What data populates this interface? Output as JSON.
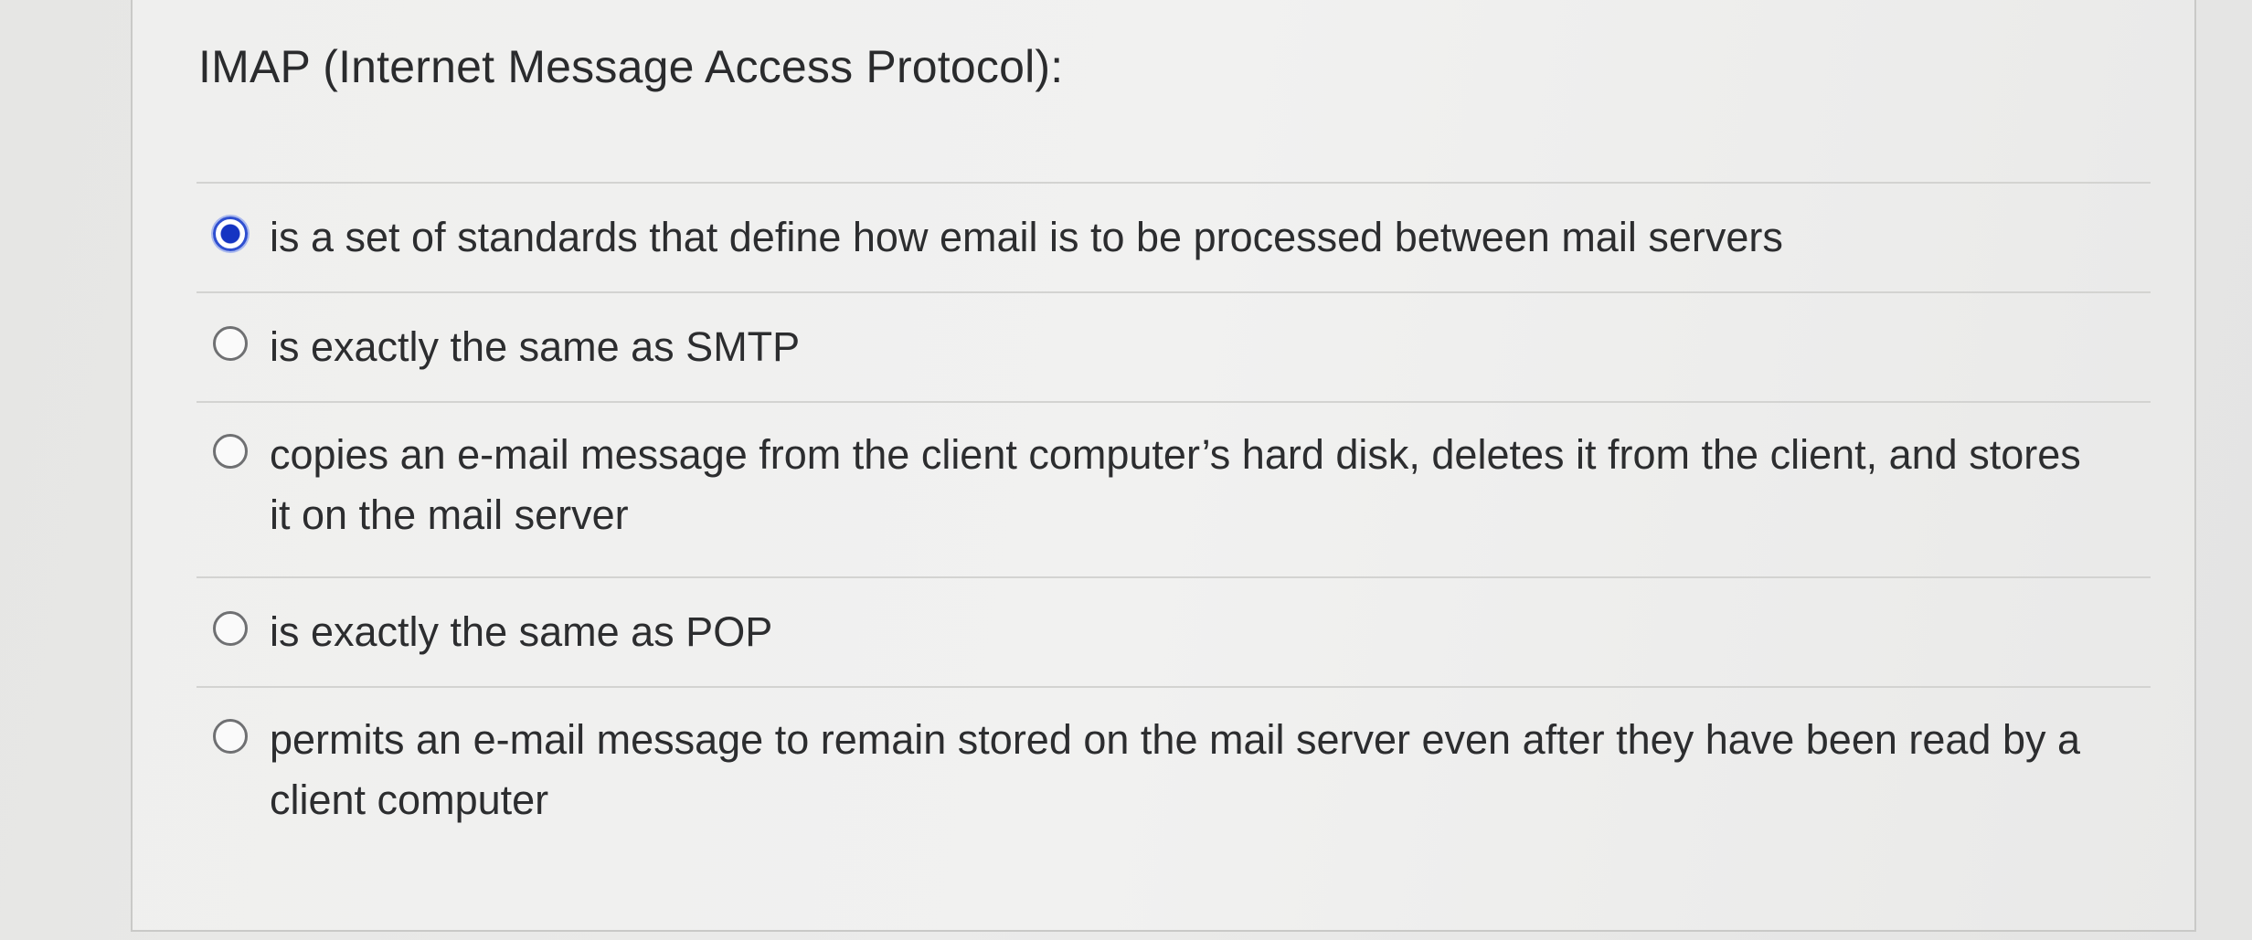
{
  "question": {
    "prompt": "IMAP (Internet Message Access Protocol):"
  },
  "options": [
    {
      "label": "is a set of standards that define how email is to be processed between mail servers",
      "selected": true
    },
    {
      "label": "is exactly the same as SMTP",
      "selected": false
    },
    {
      "label": "copies an e-mail message from the client computer’s hard disk, deletes it from the client, and stores it on the mail server",
      "selected": false
    },
    {
      "label": "is exactly the same as POP",
      "selected": false
    },
    {
      "label": "permits an e-mail message to remain stored on the mail server even after they have been read by a client computer",
      "selected": false
    }
  ],
  "colors": {
    "radio_selected": "#1534c2",
    "radio_unselected_border": "#6f7072",
    "text": "#2c2d2f",
    "divider": "#d3d3d1"
  }
}
